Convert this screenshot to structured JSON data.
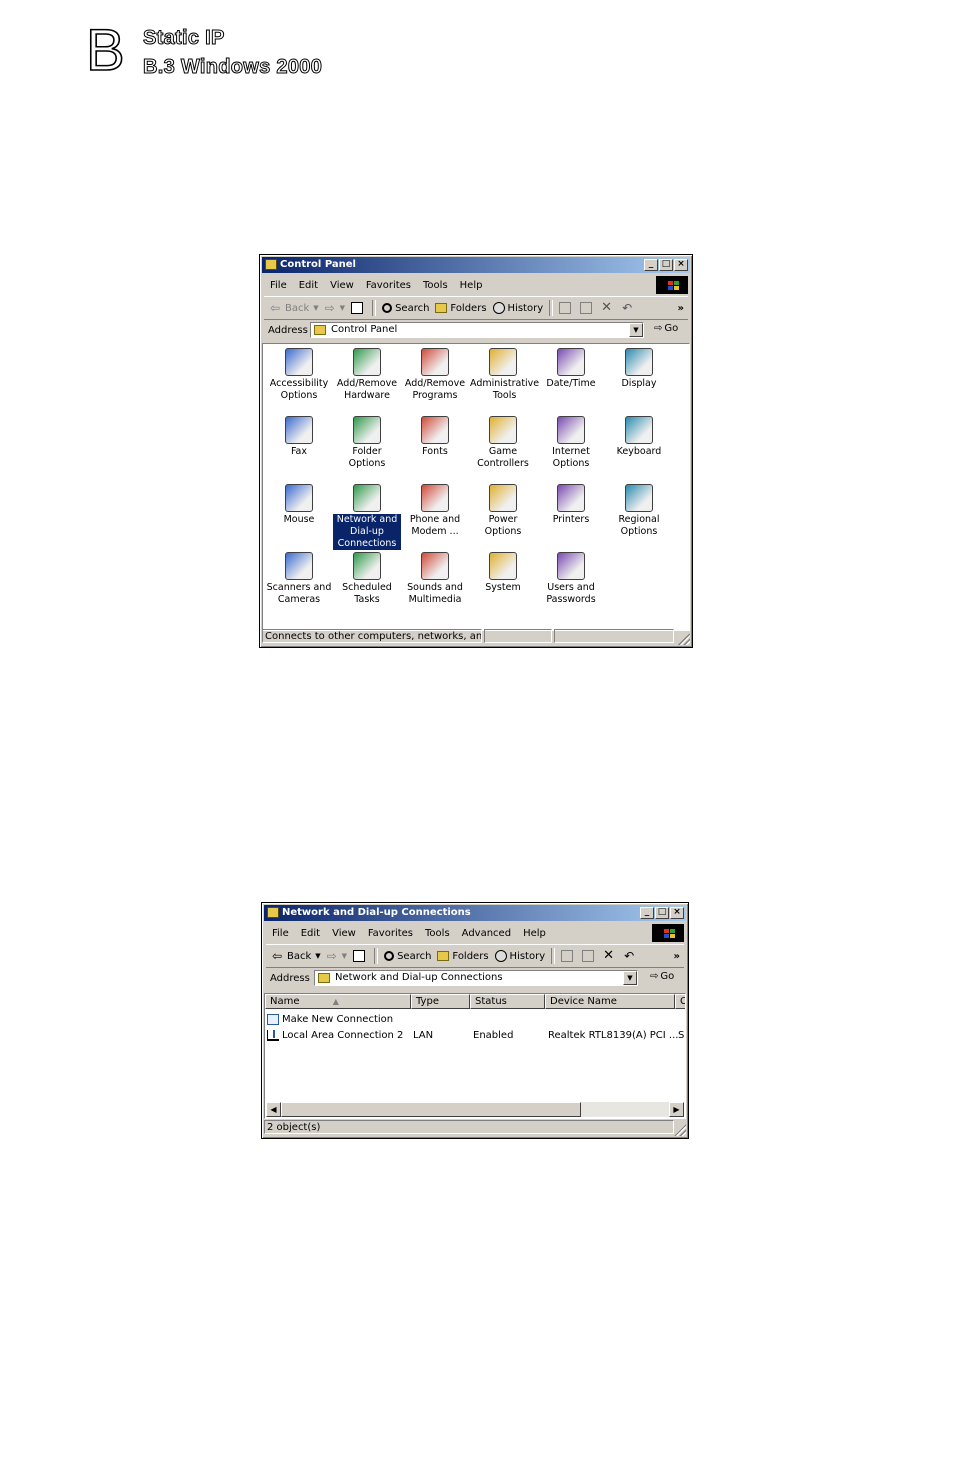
{
  "header": {
    "letter": "B",
    "title": "Static IP",
    "subtitle": "B.3  Windows 2000"
  },
  "control_panel": {
    "title": "Control Panel",
    "menu": [
      "File",
      "Edit",
      "View",
      "Favorites",
      "Tools",
      "Help"
    ],
    "toolbar": {
      "back": "Back",
      "search": "Search",
      "folders": "Folders",
      "history": "History",
      "more": "»"
    },
    "address_label": "Address",
    "address_value": "Control Panel",
    "go_label": "Go",
    "items": [
      {
        "label": "Accessibility Options",
        "icon": "accessibility-icon"
      },
      {
        "label": "Add/Remove Hardware",
        "icon": "add-remove-hardware-icon"
      },
      {
        "label": "Add/Remove Programs",
        "icon": "add-remove-programs-icon"
      },
      {
        "label": "Administrative Tools",
        "icon": "administrative-tools-icon"
      },
      {
        "label": "Date/Time",
        "icon": "date-time-icon"
      },
      {
        "label": "Display",
        "icon": "display-icon"
      },
      {
        "label": "Fax",
        "icon": "fax-icon"
      },
      {
        "label": "Folder Options",
        "icon": "folder-options-icon"
      },
      {
        "label": "Fonts",
        "icon": "fonts-icon"
      },
      {
        "label": "Game Controllers",
        "icon": "game-controllers-icon"
      },
      {
        "label": "Internet Options",
        "icon": "internet-options-icon"
      },
      {
        "label": "Keyboard",
        "icon": "keyboard-icon"
      },
      {
        "label": "Mouse",
        "icon": "mouse-icon"
      },
      {
        "label": "Network and Dial-up Connections",
        "icon": "network-icon",
        "selected": true
      },
      {
        "label": "Phone and Modem ...",
        "icon": "phone-modem-icon"
      },
      {
        "label": "Power Options",
        "icon": "power-options-icon"
      },
      {
        "label": "Printers",
        "icon": "printers-icon"
      },
      {
        "label": "Regional Options",
        "icon": "regional-options-icon"
      },
      {
        "label": "Scanners and Cameras",
        "icon": "scanners-cameras-icon"
      },
      {
        "label": "Scheduled Tasks",
        "icon": "scheduled-tasks-icon"
      },
      {
        "label": "Sounds and Multimedia",
        "icon": "sounds-multimedia-icon"
      },
      {
        "label": "System",
        "icon": "system-icon"
      },
      {
        "label": "Users and Passwords",
        "icon": "users-passwords-icon"
      }
    ],
    "status_text": "Connects to other computers, networks, and the In"
  },
  "network_window": {
    "title": "Network and Dial-up Connections",
    "menu": [
      "File",
      "Edit",
      "View",
      "Favorites",
      "Tools",
      "Advanced",
      "Help"
    ],
    "toolbar": {
      "back": "Back",
      "search": "Search",
      "folders": "Folders",
      "history": "History",
      "more": "»"
    },
    "address_label": "Address",
    "address_value": "Network and Dial-up Connections",
    "go_label": "Go",
    "columns": [
      "Name",
      "Type",
      "Status",
      "Device Name",
      "C"
    ],
    "rows": [
      {
        "name": "Make New Connection",
        "type": "",
        "status": "",
        "device": "",
        "extra": ""
      },
      {
        "name": "Local Area Connection 2",
        "type": "LAN",
        "status": "Enabled",
        "device": "Realtek RTL8139(A) PCI ...",
        "extra": "S"
      }
    ],
    "status_text": "2 object(s)"
  }
}
